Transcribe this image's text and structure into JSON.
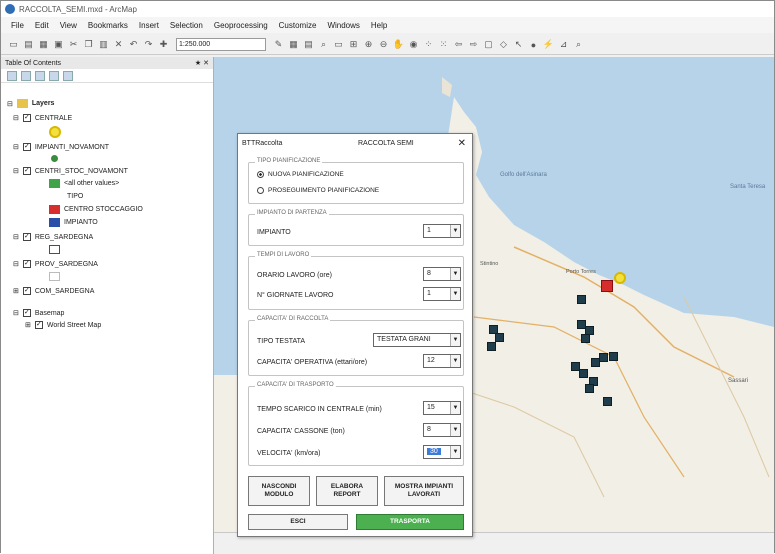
{
  "window": {
    "title": "RACCOLTA_SEMI.mxd - ArcMap"
  },
  "menu": [
    "File",
    "Edit",
    "View",
    "Bookmarks",
    "Insert",
    "Selection",
    "Geoprocessing",
    "Customize",
    "Windows",
    "Help"
  ],
  "toolbar": {
    "scale": "1:250.000"
  },
  "toc": {
    "title": "Table Of Contents",
    "pin": "★ ✕",
    "root": "Layers",
    "layers": {
      "centrale": "CENTRALE",
      "impianti": "IMPIANTI_NOVAMONT",
      "centri": "CENTRI_STOC_NOVAMONT",
      "other": "<all other values>",
      "tipo": "TIPO",
      "stoccaggio": "CENTRO STOCCAGGIO",
      "impianto": "IMPIANTO",
      "reg": "REG_SARDEGNA",
      "prov": "PROV_SARDEGNA",
      "com": "COM_SARDEGNA",
      "basemap": "Basemap",
      "street": "World Street Map"
    }
  },
  "map": {
    "labels": [
      "Golfo dell'Asinara",
      "Santa Teresa",
      "Porto Torres",
      "Sassari",
      "Stintino"
    ]
  },
  "dialog": {
    "app": "BTTRaccolta",
    "title": "RACCOLTA SEMI",
    "close": "✕",
    "g1": {
      "label": "TIPO PIANIFICAZIONE",
      "opt1": "NUOVA PIANIFICAZIONE",
      "opt2": "PROSEGUIMENTO PIANIFICAZIONE"
    },
    "g2": {
      "label": "IMPIANTO DI PARTENZA",
      "field": "IMPIANTO",
      "value": "1"
    },
    "g3": {
      "label": "TEMPI DI LAVORO",
      "f1": "ORARIO LAVORO (ore)",
      "v1": "8",
      "f2": "N° GIORNATE LAVORO",
      "v2": "1"
    },
    "g4": {
      "label": "CAPACITA' DI RACCOLTA",
      "f1": "TIPO TESTATA",
      "v1": "TESTATA GRANI",
      "f2": "CAPACITA' OPERATIVA (ettari/ore)",
      "v2": "12"
    },
    "g5": {
      "label": "CAPACITA' DI TRASPORTO",
      "f1": "TEMPO SCARICO IN CENTRALE (min)",
      "v1": "15",
      "f2": "CAPACITA' CASSONE (ton)",
      "v2": "8",
      "f3": "VELOCITA' (km/ora)",
      "v3": "30"
    },
    "buttons": {
      "hide": "NASCONDI\nMODULO",
      "process": "ELABORA\nREPORT",
      "show": "MOSTRA IMPIANTI\nLAVORATI",
      "exit": "ESCI",
      "ok": "TRASPORTA"
    }
  },
  "colors": {
    "centrale": "#f2e03c",
    "impianti": "#3a8a3f",
    "other": "#41a348",
    "stoccaggio": "#d62d2d",
    "impianto": "#2a4fa8",
    "water": "#b7d3e9",
    "land": "#f2efe6",
    "ok_button": "#4caf50"
  }
}
